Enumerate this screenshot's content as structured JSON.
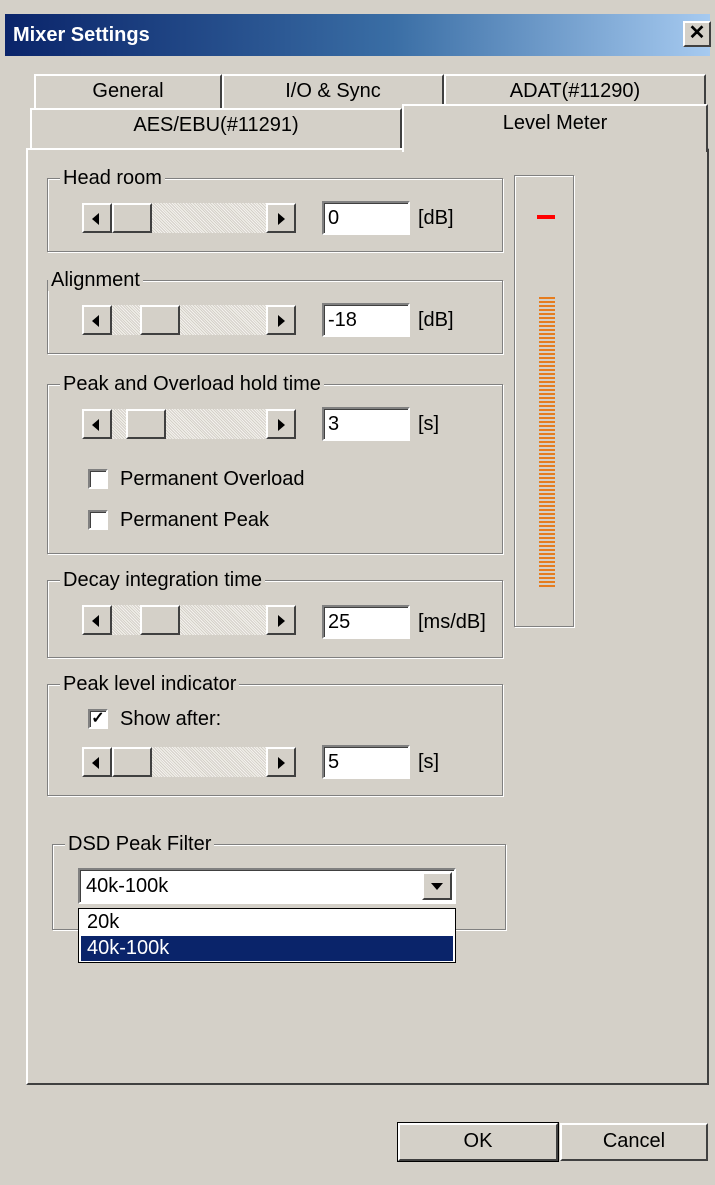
{
  "window": {
    "title": "Mixer Settings",
    "close_glyph": "✕"
  },
  "tabs": {
    "row1": [
      "General",
      "I/O & Sync",
      "ADAT(#11290)"
    ],
    "row2": [
      "AES/EBU(#11291)",
      "Level Meter"
    ],
    "selected": "Level Meter"
  },
  "groups": {
    "head_room": {
      "label": "Head room",
      "value": "0",
      "unit": "[dB]"
    },
    "alignment": {
      "label": "Alignment",
      "value": "-18",
      "unit": "[dB]"
    },
    "peak_hold": {
      "label": "Peak and Overload hold time",
      "value": "3",
      "unit": "[s]",
      "permanent_overload": {
        "label": "Permanent Overload",
        "checked": false
      },
      "permanent_peak": {
        "label": "Permanent Peak",
        "checked": false
      }
    },
    "decay": {
      "label": "Decay integration time",
      "value": "25",
      "unit": "[ms/dB]"
    },
    "peak_indicator": {
      "label": "Peak level indicator",
      "show_after": {
        "label": "Show after:",
        "checked": true,
        "check_glyph": "✓"
      },
      "value": "5",
      "unit": "[s]"
    },
    "dsd_filter": {
      "label": "DSD Peak Filter",
      "selected": "40k-100k",
      "options": [
        "20k",
        "40k-100k"
      ]
    }
  },
  "meter": {
    "peak_color": "#ff0000",
    "bar_color": "#e67c1e"
  },
  "buttons": {
    "ok": "OK",
    "cancel": "Cancel"
  },
  "colors": {
    "titlebar_start": "#0a246a",
    "titlebar_end": "#a6caf0",
    "face": "#d4d0c8",
    "selection": "#0a246a"
  }
}
